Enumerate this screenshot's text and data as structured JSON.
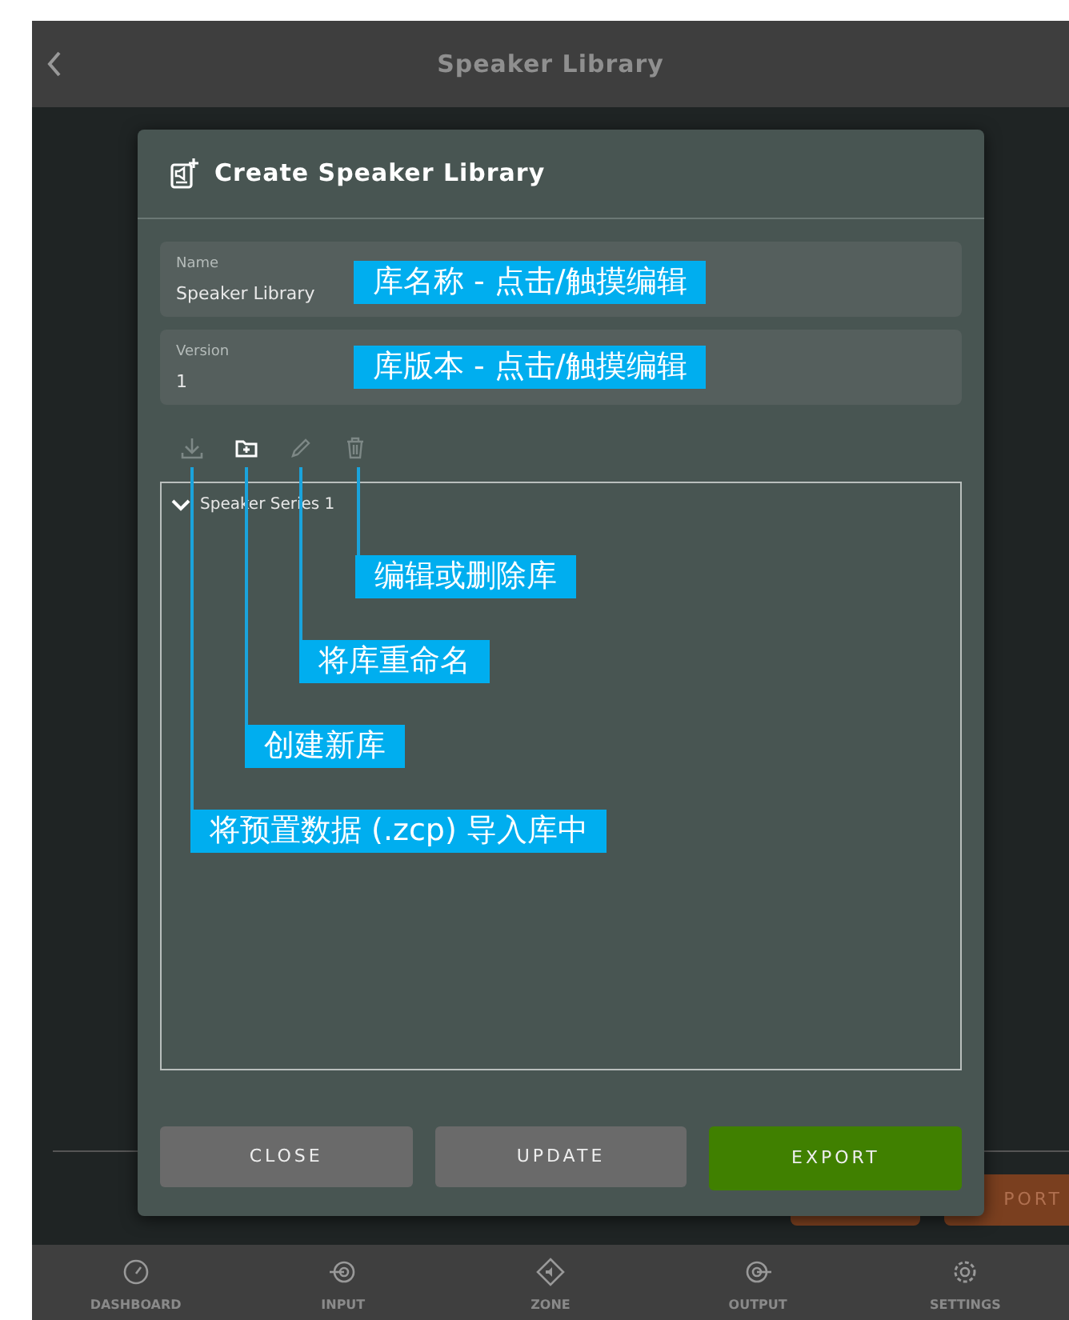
{
  "header": {
    "title": "Speaker Library"
  },
  "background": {
    "button_text": "PORT"
  },
  "dialog": {
    "title": "Create Speaker Library",
    "fields": [
      {
        "label": "Name",
        "value": "Speaker Library"
      },
      {
        "label": "Version",
        "value": "1"
      }
    ],
    "toolbar": [
      {
        "kind": "import",
        "disabled": true
      },
      {
        "kind": "new-folder",
        "disabled": false
      },
      {
        "kind": "rename",
        "disabled": true
      },
      {
        "kind": "delete",
        "disabled": true
      }
    ],
    "tree": [
      {
        "label": "Speaker Series 1",
        "expanded": true
      }
    ],
    "buttons": [
      {
        "label": "CLOSE",
        "kind": "secondary"
      },
      {
        "label": "UPDATE",
        "kind": "secondary"
      },
      {
        "label": "EXPORT",
        "kind": "primary"
      }
    ]
  },
  "annotations": [
    "库名称 - 点击/触摸编辑",
    "库版本 - 点击/触摸编辑",
    "编辑或删除库",
    "将库重命名",
    "创建新库",
    "将预置数据 (.zcp) 导入库中"
  ],
  "nav": [
    {
      "label": "DASHBOARD",
      "kind": "dashboard"
    },
    {
      "label": "INPUT",
      "kind": "input"
    },
    {
      "label": "ZONE",
      "kind": "zone"
    },
    {
      "label": "OUTPUT",
      "kind": "output"
    },
    {
      "label": "SETTINGS",
      "kind": "settings"
    }
  ]
}
